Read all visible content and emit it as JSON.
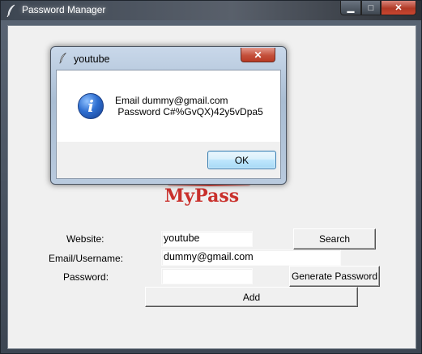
{
  "window": {
    "title": "Password Manager",
    "controls": {
      "minimize": "▁",
      "maximize": "□",
      "close": "✕"
    }
  },
  "logo": {
    "text": "MyPass",
    "color": "#c9302c"
  },
  "form": {
    "website_label": "Website:",
    "website_value": "youtube",
    "email_label": "Email/Username:",
    "email_value": "dummy@gmail.com",
    "password_label": "Password:",
    "password_value": "",
    "search_label": "Search",
    "generate_label": "Generate Password",
    "add_label": "Add"
  },
  "dialog": {
    "title": "youtube",
    "close": "✕",
    "icon": "info-icon",
    "message_line1": "Email dummy@gmail.com",
    "message_line2": " Password C#%GvQX)42y5vDpa5",
    "ok_label": "OK"
  }
}
